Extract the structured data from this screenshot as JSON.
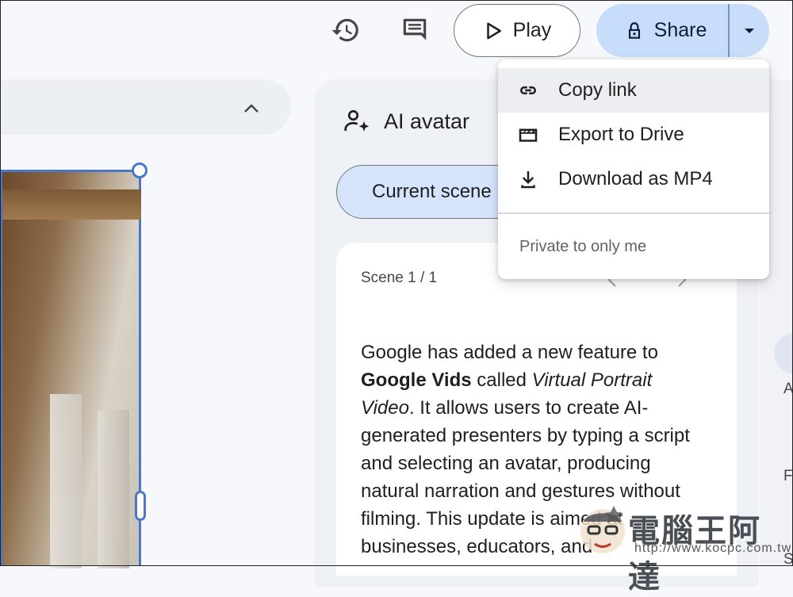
{
  "toolbar": {
    "play_label": "Play",
    "share_label": "Share",
    "icons": [
      "history-icon",
      "comment-icon",
      "play-icon",
      "lock-icon",
      "dropdown-arrow-icon"
    ]
  },
  "share_menu": {
    "items": [
      {
        "label": "Copy link",
        "icon": "link-icon"
      },
      {
        "label": "Export to Drive",
        "icon": "clapperboard-icon"
      },
      {
        "label": "Download as MP4",
        "icon": "download-icon"
      }
    ],
    "footer": "Private to only me"
  },
  "avatar_panel": {
    "title": "AI avatar",
    "scene_tab": "Current scene",
    "scene_counter": "Scene 1 / 1",
    "script_parts": {
      "p1": "Google has added a new feature to ",
      "bold": "Google Vids",
      "p2": " called ",
      "italic1": "Virtual Portrait",
      "italic2": "Video",
      "p3": ". It allows users to create AI-generated presenters by typing a script and selecting an avatar, producing natural narration and gestures without filming. This update is aimed at businesses, educators, and"
    }
  },
  "right_edge": {
    "letters": [
      "A",
      "F",
      "S"
    ]
  },
  "watermark": {
    "text": "電腦王阿達",
    "url": "http://www.kocpc.com.tw"
  },
  "colors": {
    "share_bg": "#c8ddf9",
    "selection": "#4a78c8",
    "scene_chip_bg": "#d5e3fb"
  }
}
